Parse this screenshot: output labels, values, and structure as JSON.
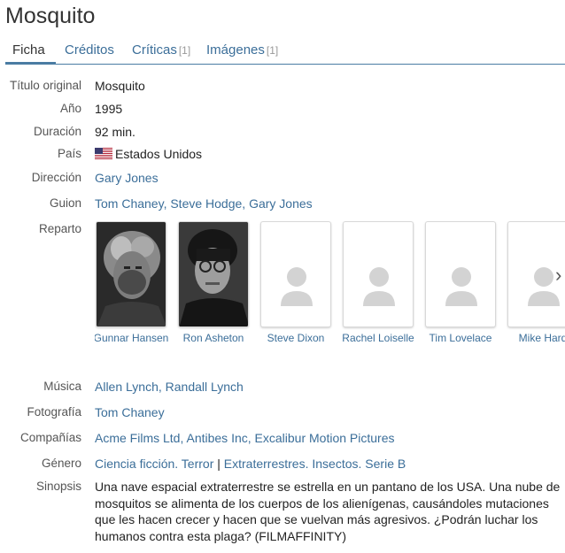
{
  "title": "Mosquito",
  "tabs": [
    {
      "label": "Ficha",
      "count": ""
    },
    {
      "label": "Créditos",
      "count": ""
    },
    {
      "label": "Críticas",
      "count": "[1]"
    },
    {
      "label": "Imágenes",
      "count": "[1]"
    }
  ],
  "details": {
    "titulo_original": {
      "label": "Título original",
      "value": "Mosquito"
    },
    "anio": {
      "label": "Año",
      "value": "1995"
    },
    "duracion": {
      "label": "Duración",
      "value": "92 min."
    },
    "pais": {
      "label": "País",
      "value": "Estados Unidos",
      "flag_icon": "us-flag-icon"
    },
    "direccion": {
      "label": "Dirección",
      "names": [
        "Gary Jones"
      ]
    },
    "guion": {
      "label": "Guion",
      "names": [
        "Tom Chaney",
        "Steve Hodge",
        "Gary Jones"
      ]
    },
    "reparto": {
      "label": "Reparto"
    },
    "musica": {
      "label": "Música",
      "names": [
        "Allen Lynch",
        "Randall Lynch"
      ]
    },
    "fotografia": {
      "label": "Fotografía",
      "names": [
        "Tom Chaney"
      ]
    },
    "companias": {
      "label": "Compañías",
      "names": [
        "Acme Films Ltd",
        "Antibes Inc",
        "Excalibur Motion Pictures"
      ]
    },
    "genero": {
      "label": "Género",
      "group1": [
        "Ciencia ficción.",
        "Terror"
      ],
      "separator": "|",
      "group2": [
        "Extraterrestres.",
        "Insectos.",
        "Serie B"
      ]
    },
    "sinopsis": {
      "label": "Sinopsis",
      "value": "Una nave espacial extraterrestre se estrella en un pantano de los USA. Una nube de mosquitos se alimenta de los cuerpos de los alienígenas, causándoles mutaciones que les hacen crecer y hacen que se vuelvan más agresivos. ¿Podrán luchar los humanos contra esta plaga? (FILMAFFINITY)"
    }
  },
  "cast": [
    {
      "name": "Gunnar Hansen",
      "photo": "portrait",
      "icon": "actor-photo"
    },
    {
      "name": "Ron Asheton",
      "photo": "portrait",
      "icon": "actor-photo"
    },
    {
      "name": "Steve Dixon",
      "photo": "placeholder",
      "icon": "person-placeholder-icon"
    },
    {
      "name": "Rachel Loiselle",
      "photo": "placeholder",
      "icon": "person-placeholder-icon"
    },
    {
      "name": "Tim Lovelace",
      "photo": "placeholder",
      "icon": "person-placeholder-icon"
    },
    {
      "name": "Mike Hard",
      "photo": "placeholder",
      "icon": "person-placeholder-icon"
    }
  ],
  "colors": {
    "link": "#3b6e99",
    "tab_accent": "#4a7ca3",
    "label": "#555555"
  }
}
